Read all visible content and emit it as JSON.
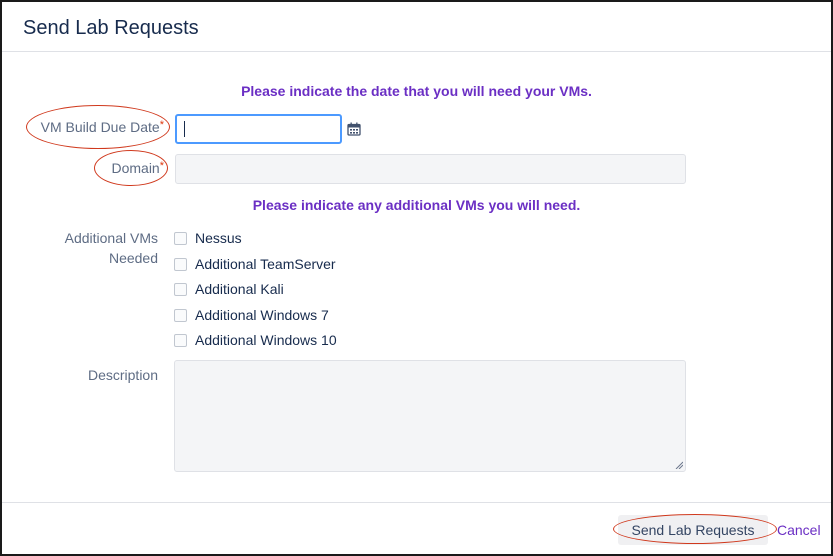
{
  "dialog": {
    "title": "Send Lab Requests"
  },
  "instructions": {
    "date": "Please indicate the date that you will need your VMs.",
    "vms": "Please indicate any additional VMs you will need."
  },
  "fields": {
    "due_date": {
      "label": "VM Build Due Date",
      "required_mark": "*",
      "value": ""
    },
    "domain": {
      "label": "Domain",
      "required_mark": "*",
      "value": ""
    },
    "additional_vms": {
      "label_line1": "Additional VMs",
      "label_line2": "Needed",
      "options": [
        {
          "label": "Nessus",
          "checked": false
        },
        {
          "label": "Additional TeamServer",
          "checked": false
        },
        {
          "label": "Additional Kali",
          "checked": false
        },
        {
          "label": "Additional Windows 7",
          "checked": false
        },
        {
          "label": "Additional Windows 10",
          "checked": false
        }
      ]
    },
    "description": {
      "label": "Description",
      "value": ""
    }
  },
  "footer": {
    "submit_label": "Send Lab Requests",
    "cancel_label": "Cancel"
  },
  "icons": {
    "date_picker": "calendar-icon"
  },
  "colors": {
    "instruction_text": "#6b2fc4",
    "required_asterisk": "#de350b",
    "annotation_ellipse": "#d0391d",
    "focus_border": "#4c9aff"
  }
}
